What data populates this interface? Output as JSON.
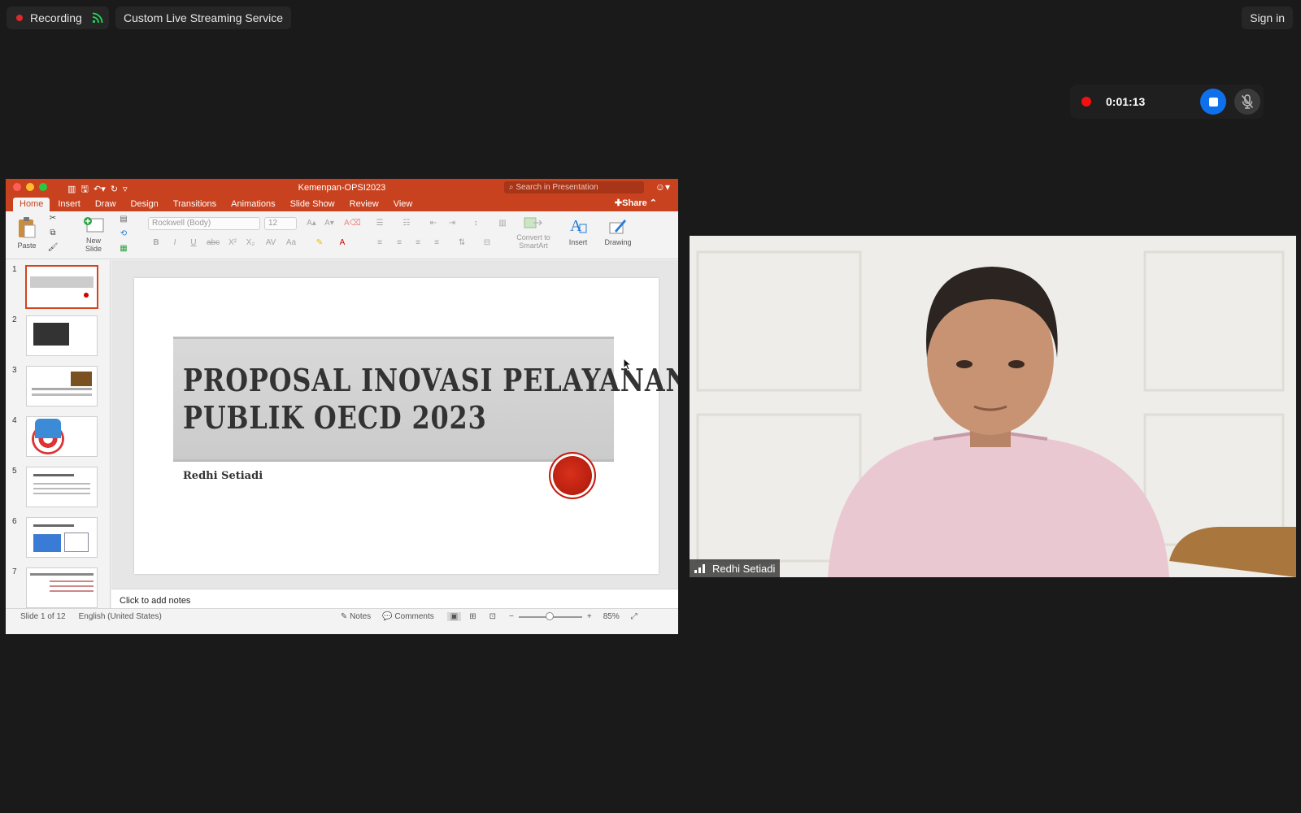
{
  "topbar": {
    "recording_label": "Recording",
    "stream_label": "Custom Live Streaming Service",
    "signin_label": "Sign in"
  },
  "recording_widget": {
    "timer": "0:01:13"
  },
  "ppt": {
    "doc_title": "Kemenpan-OPSI2023",
    "search_placeholder": "Search in Presentation",
    "tabs": [
      "Home",
      "Insert",
      "Draw",
      "Design",
      "Transitions",
      "Animations",
      "Slide Show",
      "Review",
      "View"
    ],
    "share_label": "Share",
    "ribbon": {
      "paste": "Paste",
      "new_slide_1": "New",
      "new_slide_2": "Slide",
      "font_name": "Rockwell (Body)",
      "font_size": "12",
      "convert_1": "Convert to",
      "convert_2": "SmartArt",
      "insert": "Insert",
      "drawing": "Drawing"
    },
    "thumbnails": [
      "1",
      "2",
      "3",
      "4",
      "5",
      "6",
      "7"
    ],
    "slide": {
      "title_line1": "PROPOSAL INOVASI PELAYANAN",
      "title_line2": "PUBLIK OECD 2023",
      "author": "Redhi Setiadi"
    },
    "notes_placeholder": "Click to add notes",
    "status": {
      "slide_count": "Slide 1 of 12",
      "language": "English (United States)",
      "notes": "Notes",
      "comments": "Comments",
      "zoom": "85%"
    }
  },
  "video": {
    "participant_name": "Redhi Setiadi"
  },
  "colors": {
    "ppt_accent": "#c8421f",
    "record_red": "#f51010",
    "stop_blue": "#0e71eb"
  }
}
